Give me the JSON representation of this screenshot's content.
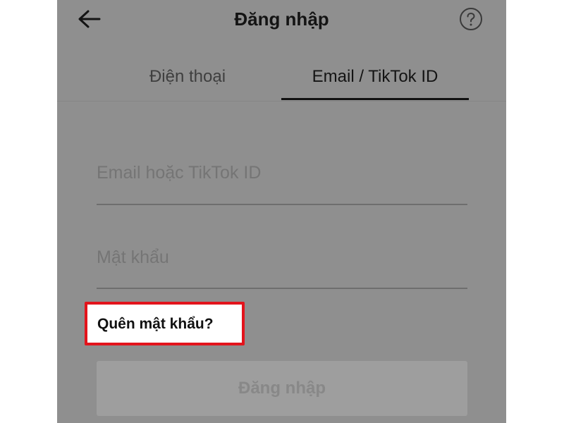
{
  "header": {
    "title": "Đăng nhập",
    "back_icon": "arrow-left-icon",
    "help_icon": "question-circle-icon"
  },
  "tabs": [
    {
      "label": "Điện thoại",
      "active": false
    },
    {
      "label": "Email / TikTok ID",
      "active": true
    }
  ],
  "form": {
    "email_placeholder": "Email hoặc TikTok ID",
    "password_placeholder": "Mật khẩu",
    "forgot_password": "Quên mật khẩu?",
    "login_button": "Đăng nhập"
  },
  "colors": {
    "overlay_gray": "#8f8f8f",
    "highlight_red": "#e3141c",
    "text_dark": "#141414"
  }
}
